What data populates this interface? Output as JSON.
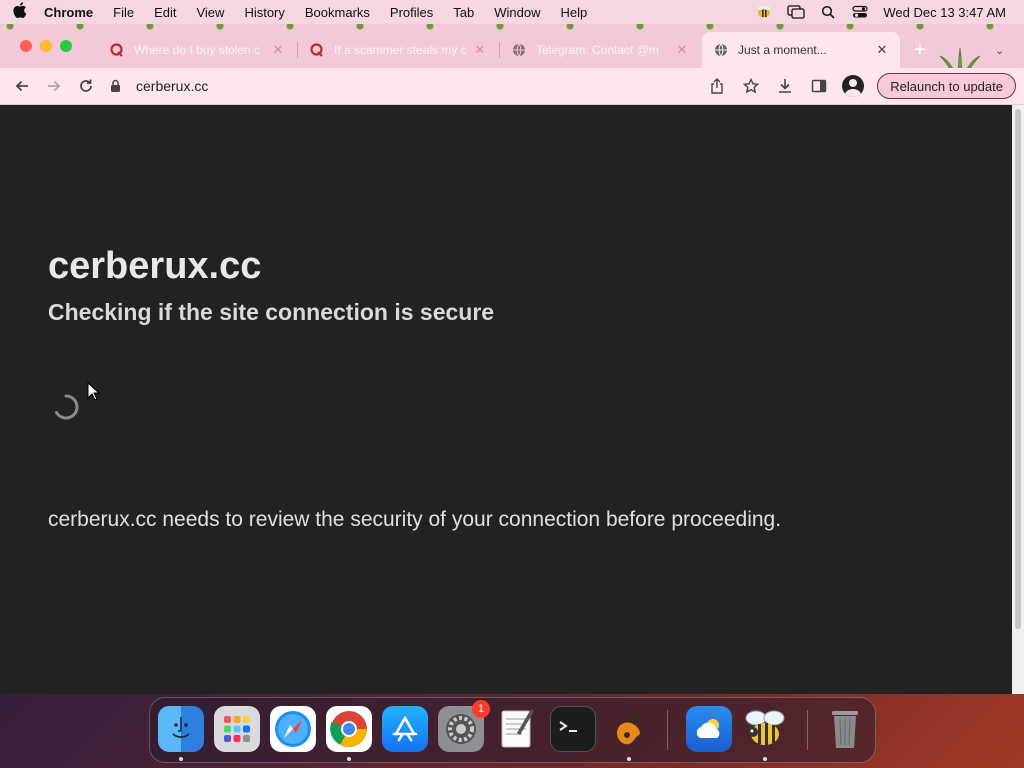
{
  "menubar": {
    "app_name": "Chrome",
    "items": [
      "File",
      "Edit",
      "View",
      "History",
      "Bookmarks",
      "Profiles",
      "Tab",
      "Window",
      "Help"
    ],
    "clock": "Wed Dec 13  3:47 AM"
  },
  "tabs": [
    {
      "title": "Where do I buy stolen c",
      "favicon": "quora-icon"
    },
    {
      "title": "If a scammer steals my c",
      "favicon": "quora-icon"
    },
    {
      "title": "Telegram: Contact @m",
      "favicon": "globe-icon"
    },
    {
      "title": "Just a moment...",
      "favicon": "globe-icon",
      "active": true
    }
  ],
  "toolbar": {
    "url": "cerberux.cc",
    "relaunch_label": "Relaunch to update"
  },
  "page": {
    "site_title": "cerberux.cc",
    "subtitle": "Checking if the site connection is secure",
    "message": "cerberux.cc needs to review the security of your connection before proceeding."
  },
  "dock": {
    "apps": [
      "Finder",
      "Launchpad",
      "Safari",
      "Google Chrome",
      "App Store",
      "System Preferences",
      "TextEdit",
      "Terminal",
      "GarageBand",
      "Weather",
      "Bee",
      "Trash"
    ],
    "system_preferences_badge": "1"
  },
  "colors": {
    "menubar": "#f6d6e2",
    "tabstrip": "#f3c9d9",
    "toolbar": "#fde6ef",
    "page_background": "#222222",
    "page_text": "#e6e6e6",
    "close_button": "#fe5f57",
    "minimize_button": "#febc2e",
    "maximize_button": "#28c840"
  }
}
